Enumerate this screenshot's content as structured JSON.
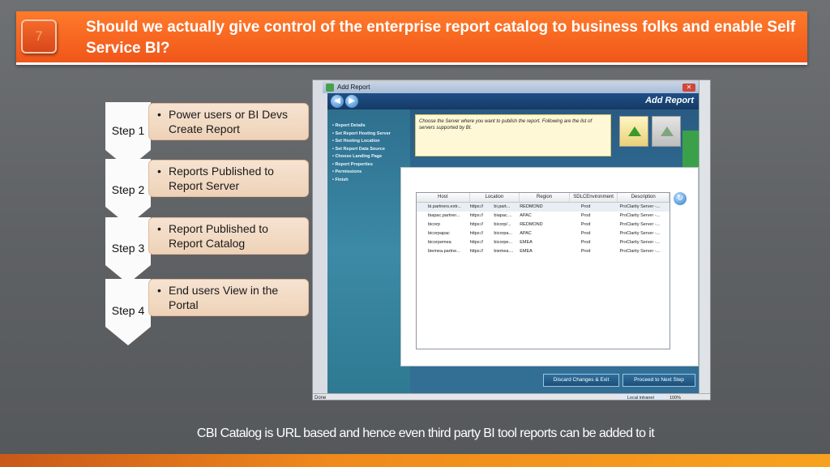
{
  "header": {
    "slide_number": "7",
    "title": "Should we actually give control of the enterprise report catalog to business folks and enable Self Service BI?"
  },
  "steps": [
    {
      "label": "Step 1",
      "text": "Power users or BI Devs Create Report"
    },
    {
      "label": "Step 2",
      "text": " Reports Published to Report Server"
    },
    {
      "label": "Step 3",
      "text": "Report Published to Report Catalog"
    },
    {
      "label": "Step 4",
      "text": "End users View in the Portal"
    }
  ],
  "bullet": "•",
  "window": {
    "title": "Add Report",
    "header_title": "Add Report",
    "sidebar_items": [
      "• Report Details",
      "• Set Report Hosting Server",
      "• Set Hosting Location",
      "• Set Report Data Source",
      "• Choose Landing Page",
      "• Report Properties",
      "• Permissions",
      "• Finish"
    ],
    "instruction": "Choose the Server where you want to publish the report. Following are the list of servers supported by      BI.",
    "buttons": {
      "discard": "Discard Changes & Exit",
      "next": "Proceed to Next Step"
    },
    "status": {
      "left": "Done",
      "zone": "Local intranet",
      "zoom": "100%"
    }
  },
  "server_table": {
    "columns": [
      "Host",
      "Location",
      "Region",
      "SDLCEnvironment",
      "Description"
    ],
    "rows": [
      [
        "bi.partners.extr...",
        "https://",
        "bi.part...",
        "REDMOND",
        "Prod",
        "ProClarity Server -..."
      ],
      [
        "biapac.partner...",
        "https://",
        "biapac....",
        "APAC",
        "Prod",
        "ProClarity Server -..."
      ],
      [
        "bicorp",
        "https://",
        "bicorp/...",
        "REDMOND",
        "Prod",
        "ProClarity Server -..."
      ],
      [
        "bicorpapac",
        "https://",
        "bicorpa...",
        "APAC",
        "Prod",
        "ProClarity Server -..."
      ],
      [
        "bicorpemea",
        "https://",
        "bicorpe...",
        "EMEA",
        "Prod",
        "ProClarity Server -..."
      ],
      [
        "biemea.partne...",
        "https://",
        "biemea....",
        "EMEA",
        "Prod",
        "ProClarity Server -..."
      ]
    ]
  },
  "caption": "CBI Catalog is URL based and hence even  third party BI tool reports can be added to it",
  "colors": {
    "banner": "#f0561a",
    "step_box": "#f6e3d1",
    "wizard_blue": "#2a5b82",
    "accent_strip": "#f7a21e"
  }
}
